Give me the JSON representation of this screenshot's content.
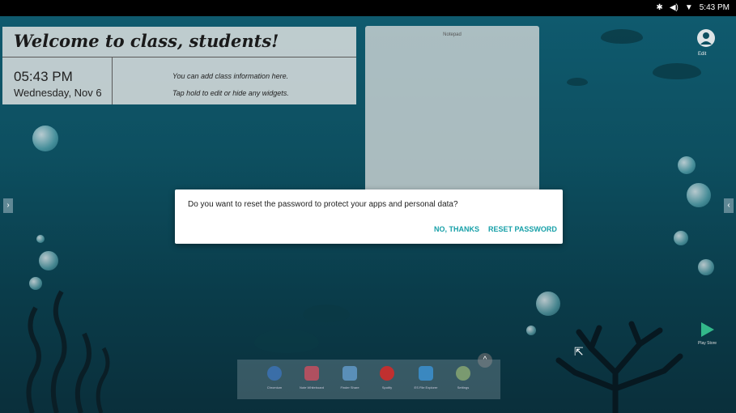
{
  "status_bar": {
    "time": "5:43 PM",
    "icons": [
      "bluetooth-icon",
      "volume-icon",
      "wifi-icon"
    ]
  },
  "welcome_widget": {
    "title": "Welcome to class, students!",
    "time": "05:43 PM",
    "date": "Wednesday, Nov 6",
    "info_line1": "You can add class information here.",
    "info_line2": "Tap hold to edit or hide any widgets."
  },
  "notepad": {
    "title": "Notepad"
  },
  "profile": {
    "label": "Edit"
  },
  "dialog": {
    "message": "Do you want to reset the password to protect your apps and personal data?",
    "no_label": "NO, THANKS",
    "reset_label": "RESET PASSWORD",
    "accent_color": "#17a0a8"
  },
  "dock": {
    "items": [
      {
        "label": "Chromium",
        "icon": "chromium-icon",
        "color": "#3a6ea8"
      },
      {
        "label": "Note Whiteboard",
        "icon": "whiteboard-icon",
        "color": "#b05060"
      },
      {
        "label": "Finder Share",
        "icon": "share-icon",
        "color": "#5a8fb8"
      },
      {
        "label": "Spotify",
        "icon": "record-icon",
        "color": "#c03030"
      },
      {
        "label": "ES File Explorer",
        "icon": "file-explorer-icon",
        "color": "#3a88c0"
      },
      {
        "label": "Settings",
        "icon": "gear-icon",
        "color": "#7a9a70"
      }
    ]
  },
  "play_store": {
    "label": "Play Store"
  }
}
